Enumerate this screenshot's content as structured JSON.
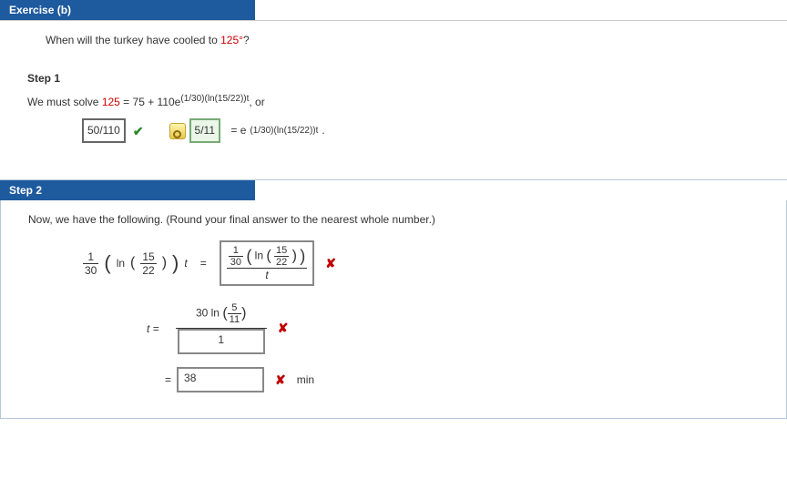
{
  "header": {
    "title": "Exercise (b)"
  },
  "question": {
    "prefix": "When will the turkey have cooled to ",
    "temp": "125°",
    "suffix": "?"
  },
  "step1": {
    "label": "Step 1",
    "sentence_prefix": "We must solve  ",
    "eq_lhs": "125",
    "eq_rhs_text": " = 75 + 110e",
    "eq_rhs_exp": "(1/30)(ln(15/22))t",
    "eq_tail": ",  or",
    "input1_value": "50/110",
    "input2_value": "5/11",
    "after_input2_a": " = e",
    "after_input2_exp": "(1/30)(ln(15/22))t",
    "after_input2_b": "."
  },
  "step2": {
    "label": "Step 2",
    "intro": "Now, we have the following. (Round your final answer to the nearest whole number.)",
    "left_frac_num": "1",
    "left_frac_den": "30",
    "ln": "ln",
    "inner_frac_num": "15",
    "inner_frac_den": "22",
    "t": "t",
    "eq": "=",
    "box1_num_a": "1",
    "box1_num_b": "30",
    "box1_ln_num": "15",
    "box1_ln_den": "22",
    "box1_bottom": "t",
    "row2_prefix": "t  =",
    "row2_top_pre": "30 ln",
    "row2_top_num": "5",
    "row2_top_den": "11",
    "row2_bottom": "1",
    "row3_eq": "=",
    "row3_val": "38",
    "row3_unit": "min"
  }
}
